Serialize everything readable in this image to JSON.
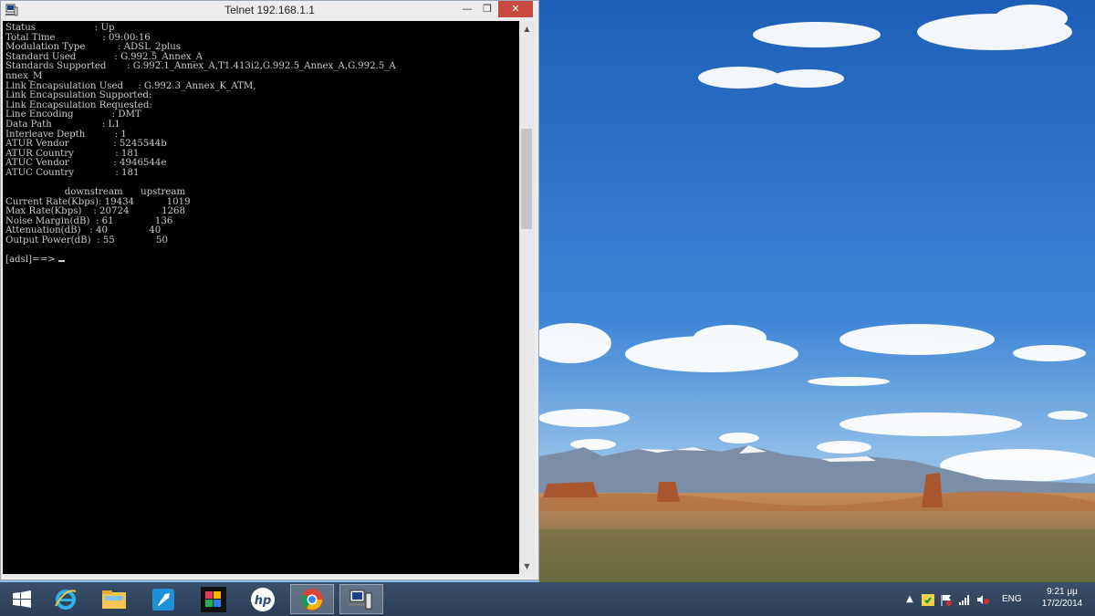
{
  "window": {
    "title": "Telnet 192.168.1.1",
    "minimize_glyph": "—",
    "maximize_glyph": "❐",
    "close_glyph": "✕"
  },
  "console": {
    "lines": [
      "Status                    : Up",
      "Total Time                : 09:00:16",
      "Modulation Type           : ADSL_2plus",
      "Standard Used             : G.992.5_Annex_A",
      "Standards Supported       : G.992.1_Annex_A,T1.413i2,G.992.5_Annex_A,G.992.5_A",
      "nnex_M",
      "Link Encapsulation Used     : G.992.3_Annex_K_ATM,",
      "Link Encapsulation Supported:",
      "Link Encapsulation Requested:",
      "Line Encoding             : DMT",
      "Data Path                 : L1",
      "Interleave Depth          : 1",
      "ATUR Vendor               : 5245544b",
      "ATUR Country              : 181",
      "ATUC Vendor               : 4946544e",
      "ATUC Country              : 181",
      "",
      "                    downstream      upstream",
      "Current Rate(Kbps): 19434           1019",
      "Max Rate(Kbps)    : 20724           1268",
      "Noise Margin(dB)  : 61              136",
      "Attenuation(dB)   : 40              40",
      "Output Power(dB)  : 55              50",
      "",
      "[adsl]==> "
    ]
  },
  "taskbar": {
    "items": [
      {
        "name": "start-button",
        "icon": "windows-logo-icon"
      },
      {
        "name": "internet-explorer",
        "icon": "internet-explorer-icon"
      },
      {
        "name": "file-explorer",
        "icon": "folder-icon"
      },
      {
        "name": "rocket-app",
        "icon": "rocket-icon"
      },
      {
        "name": "picture-app",
        "icon": "picture-app-icon"
      },
      {
        "name": "hp-app",
        "icon": "hp-logo-icon"
      },
      {
        "name": "chrome",
        "icon": "chrome-icon"
      },
      {
        "name": "telnet",
        "icon": "telnet-icon"
      }
    ],
    "tray": {
      "language": "ENG",
      "time": "9:21 μμ",
      "date": "17/2/2014"
    }
  },
  "colors": {
    "console_bg": "#000000",
    "console_fg": "#c9c9c9",
    "close_button": "#c8493f",
    "taskbar": "#33475f"
  }
}
